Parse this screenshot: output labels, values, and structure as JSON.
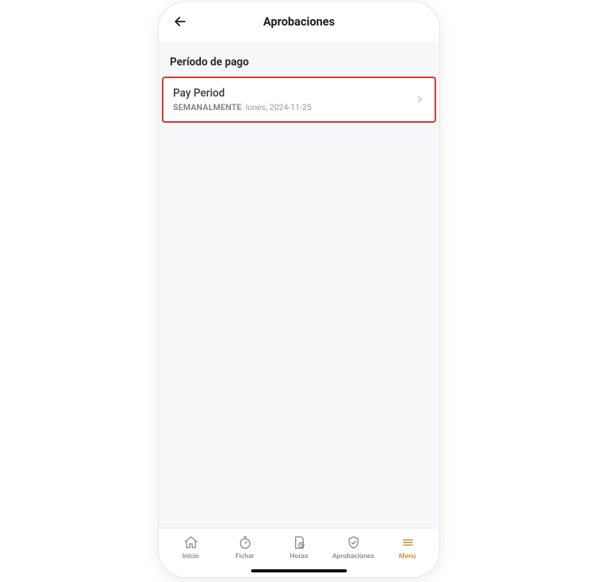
{
  "header": {
    "title": "Aprobaciones"
  },
  "section": {
    "label": "Período de pago"
  },
  "payPeriod": {
    "title": "Pay Period",
    "frequency": "SEMANALMENTE",
    "date": "lunes, 2024-11-25"
  },
  "nav": {
    "items": [
      {
        "label": "Inicio"
      },
      {
        "label": "Fichar"
      },
      {
        "label": "Horas"
      },
      {
        "label": "Aprobaciones"
      },
      {
        "label": "Menú"
      }
    ]
  }
}
